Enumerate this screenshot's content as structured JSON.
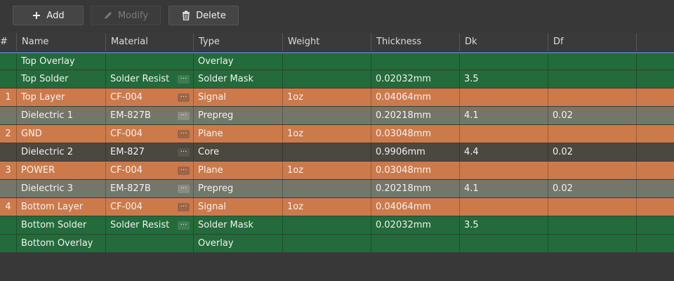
{
  "toolbar": {
    "add_label": "Add",
    "modify_label": "Modify",
    "delete_label": "Delete",
    "add_icon": "plus-icon",
    "modify_icon": "pencil-icon",
    "delete_icon": "trash-icon"
  },
  "table": {
    "columns": [
      "#",
      "Name",
      "Material",
      "Type",
      "Weight",
      "Thickness",
      "Dk",
      "Df"
    ],
    "more_glyph": "···",
    "rows": [
      {
        "num": "",
        "name": "Top Overlay",
        "material": "",
        "type": "Overlay",
        "weight": "",
        "thickness": "",
        "dk": "",
        "df": "",
        "kind": "overlay",
        "has_more": false
      },
      {
        "num": "",
        "name": "Top Solder",
        "material": "Solder Resist",
        "type": "Solder Mask",
        "weight": "",
        "thickness": "0.02032mm",
        "dk": "3.5",
        "df": "",
        "kind": "mask",
        "has_more": true
      },
      {
        "num": "1",
        "name": "Top Layer",
        "material": "CF-004",
        "type": "Signal",
        "weight": "1oz",
        "thickness": "0.04064mm",
        "dk": "",
        "df": "",
        "kind": "signal",
        "has_more": true
      },
      {
        "num": "",
        "name": "Dielectric 1",
        "material": "EM-827B",
        "type": "Prepreg",
        "weight": "",
        "thickness": "0.20218mm",
        "dk": "4.1",
        "df": "0.02",
        "kind": "prepreg",
        "has_more": true
      },
      {
        "num": "2",
        "name": "GND",
        "material": "CF-004",
        "type": "Plane",
        "weight": "1oz",
        "thickness": "0.03048mm",
        "dk": "",
        "df": "",
        "kind": "signal",
        "has_more": true
      },
      {
        "num": "",
        "name": "Dielectric 2",
        "material": "EM-827",
        "type": "Core",
        "weight": "",
        "thickness": "0.9906mm",
        "dk": "4.4",
        "df": "0.02",
        "kind": "core",
        "has_more": true
      },
      {
        "num": "3",
        "name": "POWER",
        "material": "CF-004",
        "type": "Plane",
        "weight": "1oz",
        "thickness": "0.03048mm",
        "dk": "",
        "df": "",
        "kind": "signal",
        "has_more": true
      },
      {
        "num": "",
        "name": "Dielectric 3",
        "material": "EM-827B",
        "type": "Prepreg",
        "weight": "",
        "thickness": "0.20218mm",
        "dk": "4.1",
        "df": "0.02",
        "kind": "prepreg",
        "has_more": true
      },
      {
        "num": "4",
        "name": "Bottom Layer",
        "material": "CF-004",
        "type": "Signal",
        "weight": "1oz",
        "thickness": "0.04064mm",
        "dk": "",
        "df": "",
        "kind": "signal",
        "has_more": true
      },
      {
        "num": "",
        "name": "Bottom Solder",
        "material": "Solder Resist",
        "type": "Solder Mask",
        "weight": "",
        "thickness": "0.02032mm",
        "dk": "3.5",
        "df": "",
        "kind": "mask",
        "has_more": true
      },
      {
        "num": "",
        "name": "Bottom Overlay",
        "material": "",
        "type": "Overlay",
        "weight": "",
        "thickness": "",
        "dk": "",
        "df": "",
        "kind": "overlay",
        "has_more": false
      }
    ]
  },
  "colors": {
    "overlay": "#236b3a",
    "solder_mask": "#236b3a",
    "signal": "#cd7a4b",
    "prepreg": "#75766a",
    "core": "#4b4840",
    "background": "#383838",
    "selection_line": "#4a7aa0"
  }
}
